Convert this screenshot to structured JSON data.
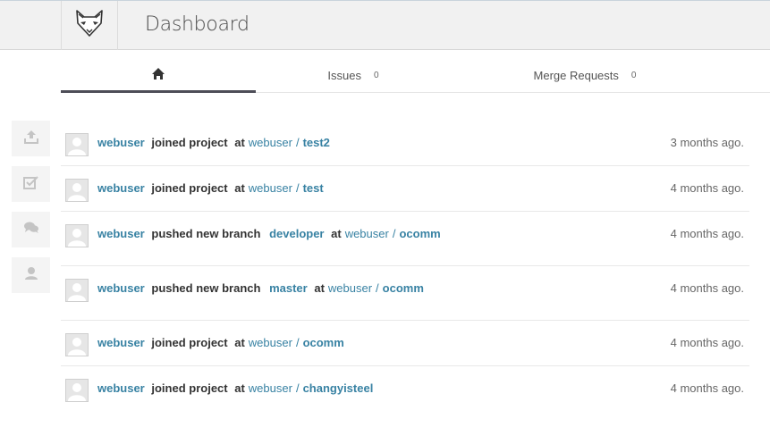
{
  "header": {
    "title": "Dashboard",
    "logo_icon": "fox-logo-icon"
  },
  "tabs": [
    {
      "icon": "home-icon",
      "label": "",
      "count": ""
    },
    {
      "label": "Issues",
      "count": "0"
    },
    {
      "label": "Merge Requests",
      "count": "0"
    }
  ],
  "sidebar": [
    {
      "icon": "upload-icon"
    },
    {
      "icon": "checkbox-icon"
    },
    {
      "icon": "chat-icon"
    },
    {
      "icon": "user-icon"
    }
  ],
  "events": [
    {
      "author": "webuser",
      "action": "joined project",
      "ref": "",
      "at": "at",
      "namespace": "webuser",
      "separator": "/",
      "project": "test2",
      "time": "3 months ago."
    },
    {
      "author": "webuser",
      "action": "joined project",
      "ref": "",
      "at": "at",
      "namespace": "webuser",
      "separator": "/",
      "project": "test",
      "time": "4 months ago."
    },
    {
      "author": "webuser",
      "action": "pushed new branch",
      "ref": "developer",
      "at": "at",
      "namespace": "webuser",
      "separator": "/",
      "project": "ocomm",
      "time": "4 months ago."
    },
    {
      "author": "webuser",
      "action": "pushed new branch",
      "ref": "master",
      "at": "at",
      "namespace": "webuser",
      "separator": "/",
      "project": "ocomm",
      "time": "4 months ago."
    },
    {
      "author": "webuser",
      "action": "joined project",
      "ref": "",
      "at": "at",
      "namespace": "webuser",
      "separator": "/",
      "project": "ocomm",
      "time": "4 months ago."
    },
    {
      "author": "webuser",
      "action": "joined project",
      "ref": "",
      "at": "at",
      "namespace": "webuser",
      "separator": "/",
      "project": "changyisteel",
      "time": "4 months ago."
    }
  ],
  "colors": {
    "link": "#3882a3",
    "text": "#333333",
    "muted": "#666666",
    "header_bg": "#f1f1f1"
  }
}
